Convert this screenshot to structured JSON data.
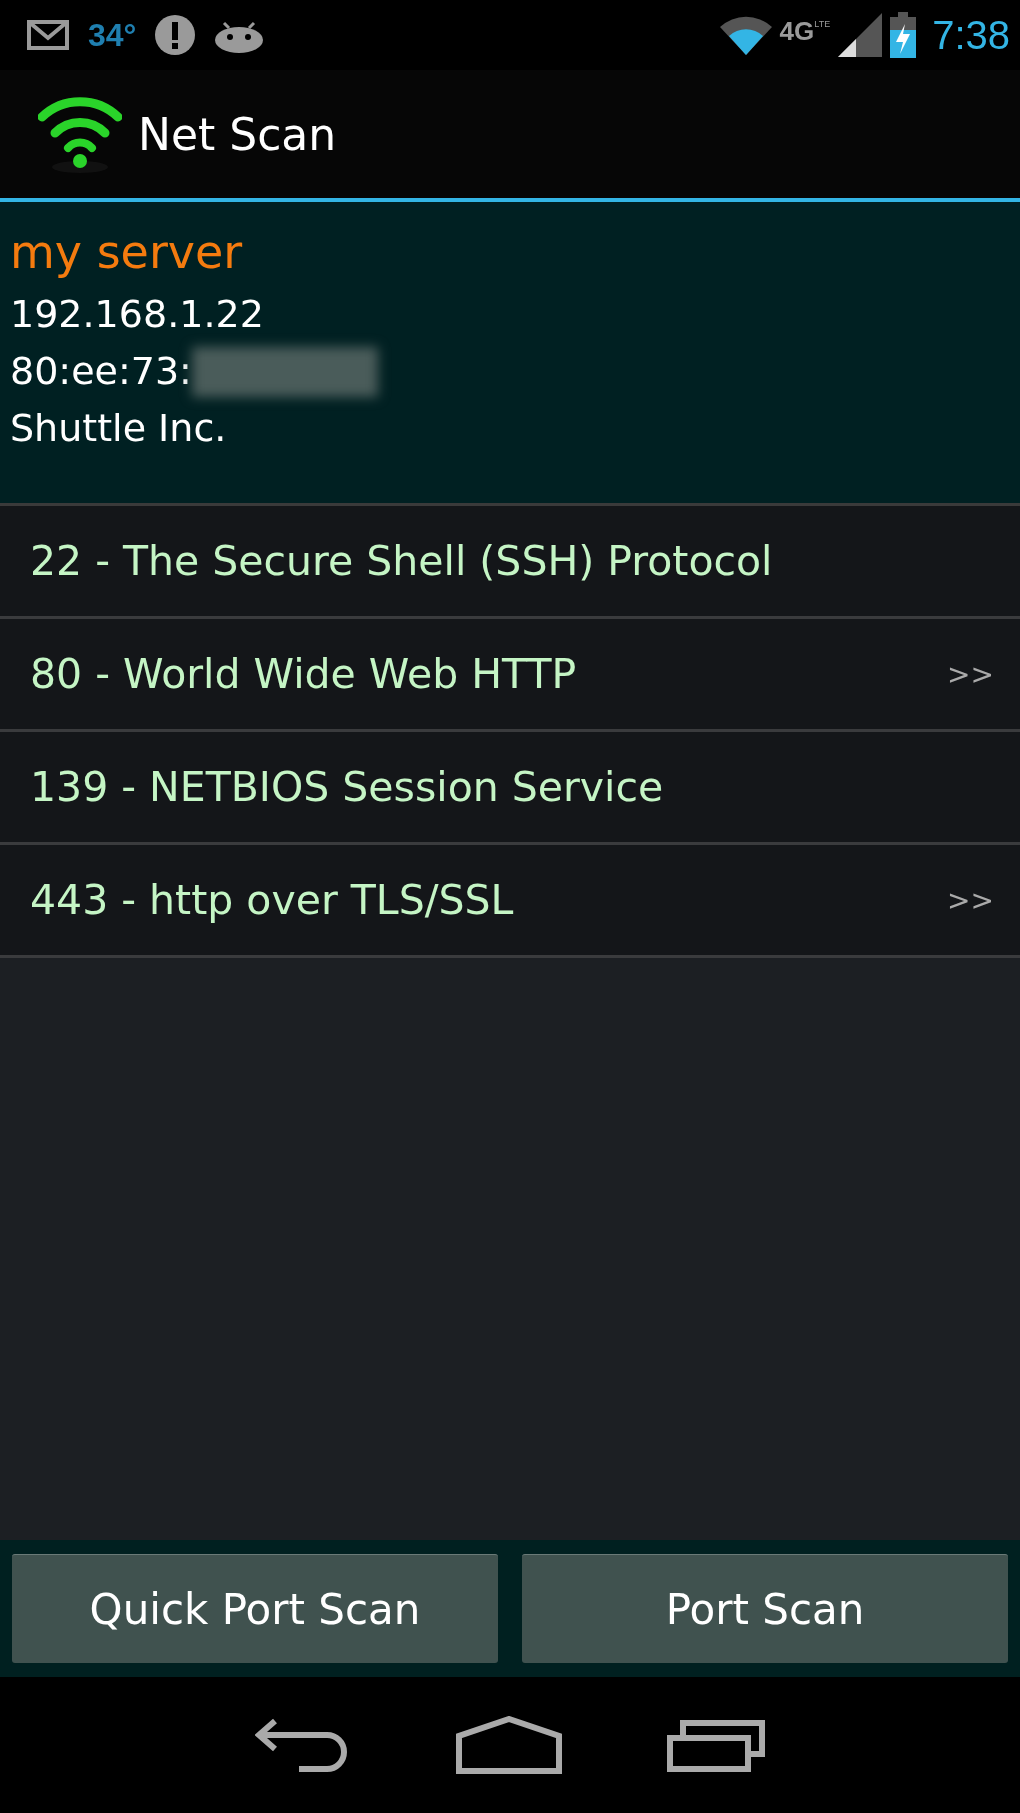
{
  "status_bar": {
    "temperature": "34°",
    "network": "4G",
    "network_sub": "LTE",
    "time": "7:38"
  },
  "action_bar": {
    "title": "Net Scan"
  },
  "host": {
    "name": "my server",
    "ip": "192.168.1.22",
    "mac": "80:ee:73:",
    "mac_redacted": true,
    "vendor": "Shuttle Inc."
  },
  "ports": [
    {
      "label": "22 - The Secure Shell (SSH) Protocol"
    },
    {
      "label": "80 - World Wide Web HTTP",
      "arrow": ">>"
    },
    {
      "label": "139 - NETBIOS Session Service"
    },
    {
      "label": "443 - http over TLS/SSL",
      "arrow": ">>"
    }
  ],
  "buttons": [
    "Quick Port Scan",
    "Port Scan"
  ]
}
